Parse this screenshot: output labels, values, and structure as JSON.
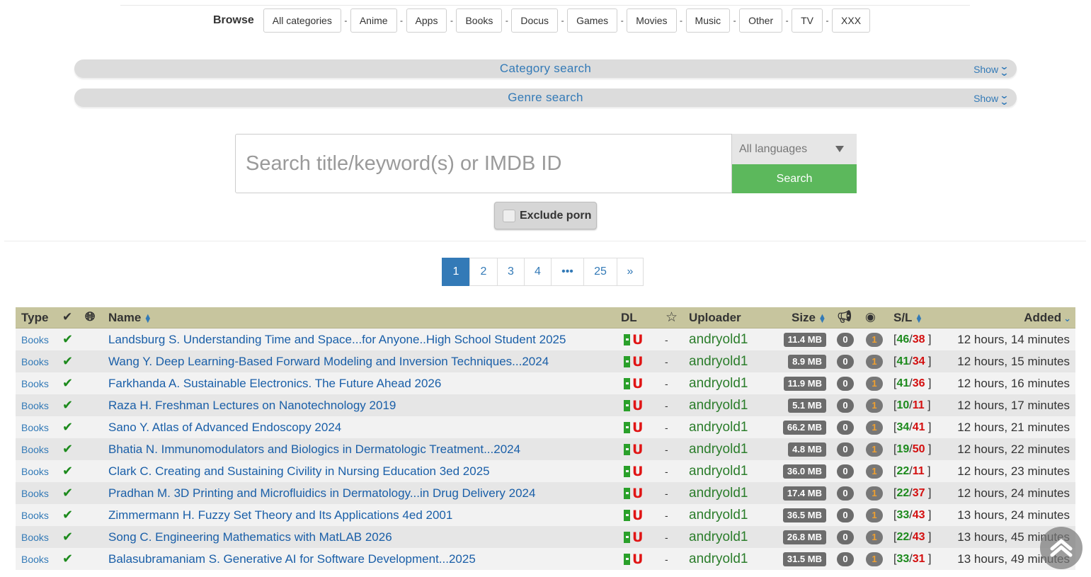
{
  "browse": {
    "label": "Browse",
    "categories": [
      "All categories",
      "Anime",
      "Apps",
      "Books",
      "Docus",
      "Games",
      "Movies",
      "Music",
      "Other",
      "TV",
      "XXX"
    ],
    "separator": "-"
  },
  "category_search": {
    "title": "Category search",
    "toggle": "Show"
  },
  "genre_search": {
    "title": "Genre search",
    "toggle": "Show"
  },
  "search": {
    "placeholder": "Search title/keyword(s) or IMDB ID",
    "language": "All languages",
    "button": "Search",
    "exclude_porn": "Exclude porn"
  },
  "pagination": {
    "pages": [
      "1",
      "2",
      "3",
      "4",
      "•••",
      "25",
      "»"
    ],
    "active": "1"
  },
  "table": {
    "headers": {
      "type": "Type",
      "name": "Name",
      "dl": "DL",
      "uploader": "Uploader",
      "size": "Size",
      "sl": "S/L",
      "added": "Added"
    },
    "rows": [
      {
        "type": "Books",
        "name": "Landsburg S. Understanding Time and Space...for Anyone..High School Student 2025",
        "uploader": "andryold1",
        "size": "11.4 MB",
        "comments": "0",
        "rating": "1",
        "seeders": "46",
        "leechers": "38",
        "added": "12 hours, 14 minutes"
      },
      {
        "type": "Books",
        "name": "Wang Y. Deep Learning-Based Forward Modeling and Inversion Techniques...2024",
        "uploader": "andryold1",
        "size": "8.9 MB",
        "comments": "0",
        "rating": "1",
        "seeders": "41",
        "leechers": "34",
        "added": "12 hours, 15 minutes"
      },
      {
        "type": "Books",
        "name": "Farkhanda A. Sustainable Electronics. The Future Ahead 2026",
        "uploader": "andryold1",
        "size": "11.9 MB",
        "comments": "0",
        "rating": "1",
        "seeders": "41",
        "leechers": "36",
        "added": "12 hours, 16 minutes"
      },
      {
        "type": "Books",
        "name": "Raza H. Freshman Lectures on Nanotechnology 2019",
        "uploader": "andryold1",
        "size": "5.1 MB",
        "comments": "0",
        "rating": "1",
        "seeders": "10",
        "leechers": "11",
        "added": "12 hours, 17 minutes"
      },
      {
        "type": "Books",
        "name": "Sano Y. Atlas of Advanced Endoscopy 2024",
        "uploader": "andryold1",
        "size": "66.2 MB",
        "comments": "0",
        "rating": "1",
        "seeders": "34",
        "leechers": "41",
        "added": "12 hours, 21 minutes"
      },
      {
        "type": "Books",
        "name": "Bhatia N. Immunomodulators and Biologics in Dermatologic Treatment...2024",
        "uploader": "andryold1",
        "size": "4.8 MB",
        "comments": "0",
        "rating": "1",
        "seeders": "19",
        "leechers": "50",
        "added": "12 hours, 22 minutes"
      },
      {
        "type": "Books",
        "name": "Clark C. Creating and Sustaining Civility in Nursing Education 3ed 2025",
        "uploader": "andryold1",
        "size": "36.0 MB",
        "comments": "0",
        "rating": "1",
        "seeders": "22",
        "leechers": "11",
        "added": "12 hours, 23 minutes"
      },
      {
        "type": "Books",
        "name": "Pradhan M. 3D Printing and Microfluidics in Dermatology...in Drug Delivery 2024",
        "uploader": "andryold1",
        "size": "17.4 MB",
        "comments": "0",
        "rating": "1",
        "seeders": "22",
        "leechers": "37",
        "added": "12 hours, 24 minutes"
      },
      {
        "type": "Books",
        "name": "Zimmermann H. Fuzzy Set Theory and Its Applications 4ed 2001",
        "uploader": "andryold1",
        "size": "36.5 MB",
        "comments": "0",
        "rating": "1",
        "seeders": "33",
        "leechers": "43",
        "added": "13 hours, 24 minutes"
      },
      {
        "type": "Books",
        "name": "Song C. Engineering Mathematics with MatLAB 2026",
        "uploader": "andryold1",
        "size": "26.8 MB",
        "comments": "0",
        "rating": "1",
        "seeders": "22",
        "leechers": "43",
        "added": "13 hours, 45 minutes"
      },
      {
        "type": "Books",
        "name": "Balasubramaniam S. Generative AI for Software Development...2025",
        "uploader": "andryold1",
        "size": "31.5 MB",
        "comments": "0",
        "rating": "1",
        "seeders": "33",
        "leechers": "31",
        "added": "13 hours, 49 minutes"
      }
    ]
  }
}
